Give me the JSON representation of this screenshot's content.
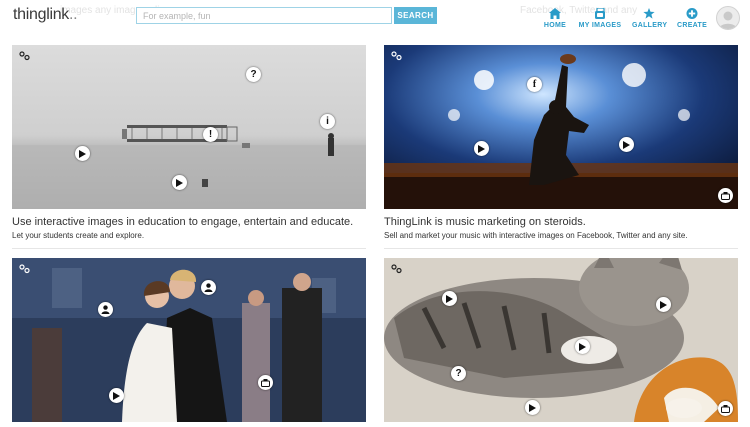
{
  "header": {
    "logo": "thinglink",
    "ghost_text_1": "images any image online",
    "ghost_text_2": "Facebook, Twitter and any",
    "search": {
      "placeholder": "For example, fun",
      "button": "SEARCH"
    },
    "nav": [
      {
        "label": "HOME",
        "icon": "home-icon"
      },
      {
        "label": "MY IMAGES",
        "icon": "images-icon"
      },
      {
        "label": "GALLERY",
        "icon": "star-icon"
      },
      {
        "label": "CREATE",
        "icon": "plus-icon"
      }
    ],
    "accent_color": "#2a9bc8"
  },
  "cards": [
    {
      "title": "Use interactive images in education to engage, entertain and educate.",
      "subtitle": "Let your students create and explore.",
      "image": "wright-flyer-photo",
      "tags": [
        "question",
        "info",
        "exclamation",
        "play",
        "play"
      ]
    },
    {
      "title": "ThingLink is music marketing on steroids.",
      "subtitle": "Sell and market your music with interactive images on Facebook, Twitter and any site.",
      "image": "concert-photo",
      "tags": [
        "facebook",
        "play",
        "play"
      ]
    },
    {
      "title": "",
      "subtitle": "",
      "image": "wedding-dance-photo",
      "tags": [
        "person",
        "person",
        "play",
        "share"
      ]
    },
    {
      "title": "",
      "subtitle": "",
      "image": "cat-and-dog-photo",
      "tags": [
        "play",
        "play",
        "play",
        "question",
        "play"
      ]
    }
  ]
}
